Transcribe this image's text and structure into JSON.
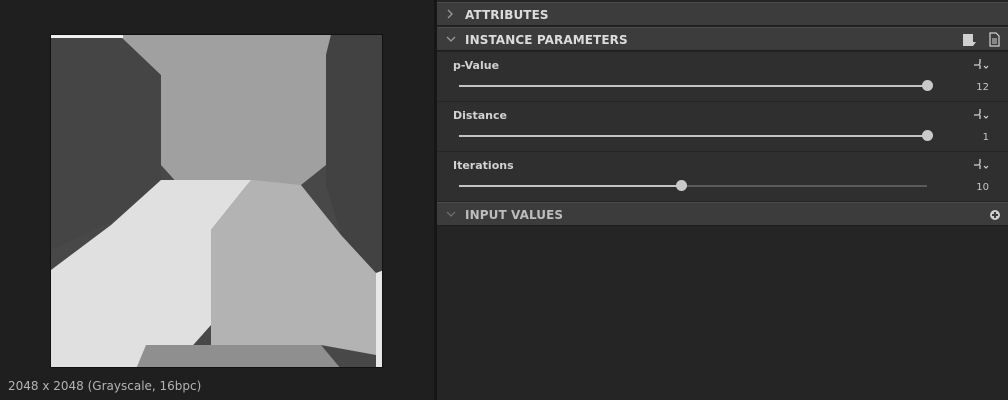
{
  "preview": {
    "info_text": "2048 x 2048 (Grayscale, 16bpc)",
    "image_icon": "voronoi-grayscale-image"
  },
  "sections": {
    "attributes": {
      "title": "ATTRIBUTES",
      "state": "collapsed"
    },
    "instance_parameters": {
      "title": "INSTANCE PARAMETERS",
      "state": "expanded"
    },
    "input_values": {
      "title": "INPUT VALUES",
      "state": "collapsed"
    }
  },
  "parameters": [
    {
      "label": "p-Value",
      "value": "12",
      "fraction": 1.0
    },
    {
      "label": "Distance",
      "value": "1",
      "fraction": 1.0
    },
    {
      "label": "Iterations",
      "value": "10",
      "fraction": 0.475
    }
  ],
  "colors": {
    "accent": "#c9c9c9",
    "header_bg": "#3c3c3c",
    "row_bg": "#2f2f2f"
  },
  "icons": {
    "section_chevron": "chevron-icon",
    "preset_save": "save-preset-icon",
    "preset_load": "load-preset-icon",
    "function": "function-graph-icon",
    "add": "add-icon"
  }
}
